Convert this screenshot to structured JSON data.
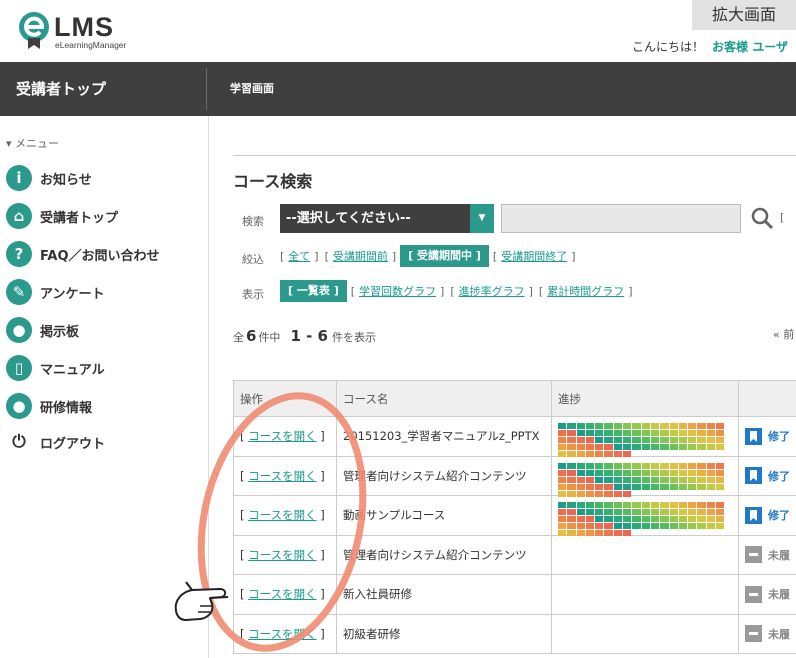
{
  "header": {
    "logo_text": "LMS",
    "logo_sub": "eLearningManager",
    "zoom_label": "拡大画面",
    "greeting": "こんにちは！",
    "user_name": "お客様 ユーザ"
  },
  "topnav": {
    "title": "受講者トップ",
    "subtitle": "学習画面"
  },
  "sidebar": {
    "menu_head": "▾ メニュー",
    "items": [
      {
        "label": "お知らせ",
        "icon": "info-icon",
        "glyph": "i"
      },
      {
        "label": "受講者トップ",
        "icon": "home-icon",
        "glyph": "⌂"
      },
      {
        "label": "FAQ／お問い合わせ",
        "icon": "question-icon",
        "glyph": "?"
      },
      {
        "label": "アンケート",
        "icon": "pencil-icon",
        "glyph": "✎"
      },
      {
        "label": "掲示板",
        "icon": "chat-bubble-icon",
        "glyph": "●"
      },
      {
        "label": "マニュアル",
        "icon": "manual-icon",
        "glyph": "▯"
      },
      {
        "label": "研修情報",
        "icon": "person-icon",
        "glyph": "●"
      },
      {
        "label": "ログアウト",
        "icon": "power-icon",
        "glyph": "⏻"
      }
    ]
  },
  "search": {
    "title": "コース検索",
    "search_label": "検索",
    "select_value": "--選択してください--",
    "bracket_fragment": "[",
    "filter_label": "絞込",
    "filters": [
      "全て",
      "受講期間前",
      "受講期間中",
      "受講期間終了"
    ],
    "filter_active": "受講期間中",
    "view_label": "表示",
    "views": [
      "一覧表",
      "学習回数グラフ",
      "進捗率グラフ",
      "累計時間グラフ"
    ],
    "view_active": "一覧表"
  },
  "results": {
    "prefix": "全",
    "total": "6",
    "unit_mid": "件中",
    "range": "1 - 6",
    "unit_end": "件を表示",
    "prev": "« 前"
  },
  "table": {
    "headers": [
      "操作",
      "コース名",
      "進捗"
    ],
    "open_label": "コースを開く",
    "rows": [
      {
        "course": "20151203_学習者マニュアルz_PPTX",
        "progress": 1.0,
        "status": "修了",
        "status_type": "done"
      },
      {
        "course": "管理者向けシステム紹介コンテンツ",
        "progress": 1.0,
        "status": "修了",
        "status_type": "done"
      },
      {
        "course": "動画サンプルコース",
        "progress": 1.0,
        "status": "修了",
        "status_type": "done"
      },
      {
        "course": "管理者向けシステム紹介コンテンツ",
        "progress": 0,
        "status": "未履",
        "status_type": "none"
      },
      {
        "course": "新入社員研修",
        "progress": 0,
        "status": "未履",
        "status_type": "none"
      },
      {
        "course": "初級者研修",
        "progress": 0,
        "status": "未履",
        "status_type": "none"
      }
    ]
  },
  "colors": {
    "accent": "#2b9a8d",
    "link": "#1a9b8c",
    "nav_bg": "#3f3f3f",
    "overlay": "#f08c72",
    "done_icon": "#1f78c8"
  }
}
